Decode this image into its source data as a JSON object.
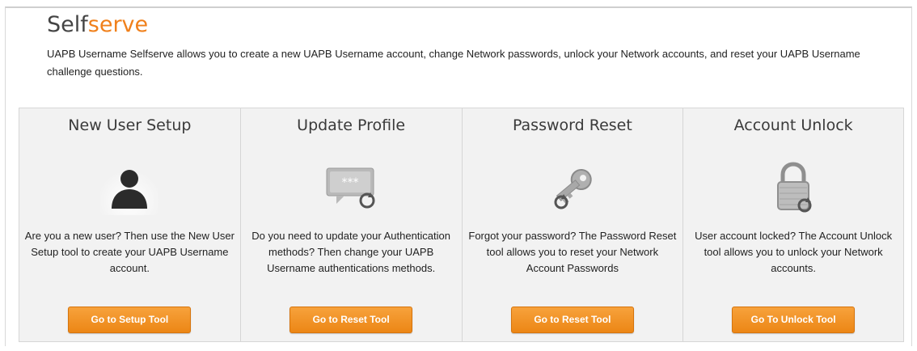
{
  "header": {
    "title_plain": "Self",
    "title_accent": "serve",
    "intro": "UAPB Username Selfserve allows you to create a new UAPB Username account, change Network passwords, unlock your Network accounts, and reset your UAPB Username challenge questions."
  },
  "colors": {
    "accent": "#f0801b",
    "button": "#ec8615",
    "panel_bg": "#f2f2f2"
  },
  "panels": [
    {
      "title": "New User Setup",
      "icon": "user-silhouette-icon",
      "description": "Are you a new user? Then use the New User Setup tool to create your UAPB Username account.",
      "button_label": "Go to Setup Tool"
    },
    {
      "title": "Update Profile",
      "icon": "password-field-refresh-icon",
      "description": "Do you need to update your Authentication methods? Then change your UAPB Username authentications methods.",
      "button_label": "Go to Reset Tool"
    },
    {
      "title": "Password Reset",
      "icon": "key-icon",
      "description": "Forgot your password? The Password Reset tool allows you to reset your Network Account Passwords",
      "button_label": "Go to Reset Tool"
    },
    {
      "title": "Account Unlock",
      "icon": "padlock-icon",
      "description": "User account locked? The Account Unlock tool allows you to unlock your Network accounts.",
      "button_label": "Go To Unlock Tool"
    }
  ]
}
